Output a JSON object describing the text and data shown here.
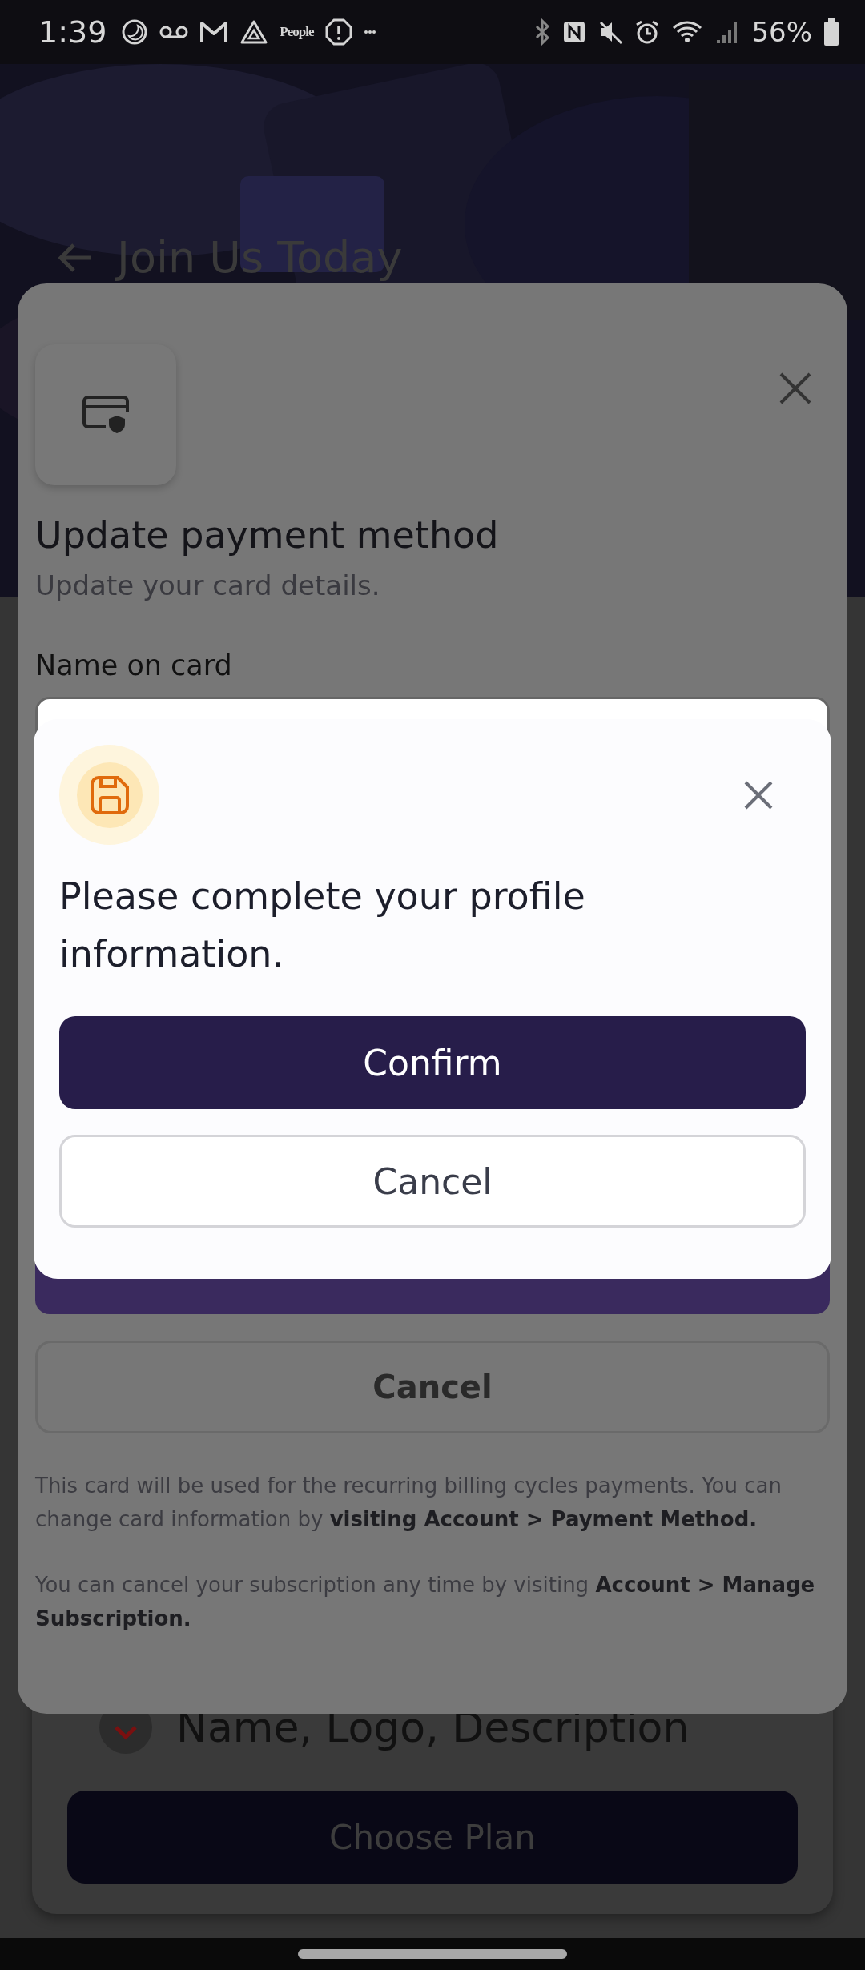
{
  "status_bar": {
    "time": "1:39",
    "app_label": "People",
    "battery": "56%"
  },
  "background": {
    "title": "Join Us Today",
    "feature": "Name, Logo, Description",
    "button": "Choose Plan"
  },
  "sheet": {
    "title": "Update payment method",
    "subtitle": "Update your card details.",
    "field_label": "Name on card",
    "cancel": "Cancel",
    "notes": [
      "This card will be used for the recurring billing cycles payments. You can change card information by **visiting Account > Payment Method.**",
      "You can cancel your subscription any time by visiting **Account > Manage Subscription.**"
    ]
  },
  "dialog": {
    "message": "Please complete your profile information.",
    "buttons": [
      {
        "label": "Confirm",
        "kind": "primary"
      },
      {
        "label": "Cancel",
        "kind": "secondary"
      }
    ]
  }
}
